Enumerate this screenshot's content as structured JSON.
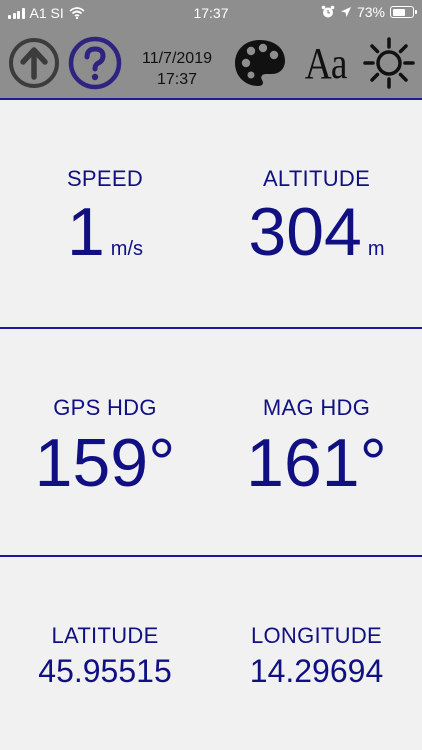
{
  "status_bar": {
    "carrier": "A1 SI",
    "time": "17:37",
    "battery": "73%",
    "battery_level": 0.73
  },
  "toolbar": {
    "date": "11/7/2019",
    "time": "17:37",
    "font_button_label": "Aa"
  },
  "panels": {
    "speed": {
      "label": "SPEED",
      "value": "1",
      "unit": "m/s"
    },
    "altitude": {
      "label": "ALTITUDE",
      "value": "304",
      "unit": "m"
    },
    "gps_heading": {
      "label": "GPS HDG",
      "value": "159°"
    },
    "mag_heading": {
      "label": "MAG HDG",
      "value": "161°"
    },
    "latitude": {
      "label": "LATITUDE",
      "value": "45.95515"
    },
    "longitude": {
      "label": "LONGITUDE",
      "value": "14.29694"
    }
  },
  "colors": {
    "accent": "#101082",
    "divider": "#1b1b9a",
    "toolbar_bg": "#8e8e8e",
    "content_bg": "#f1f1f2"
  }
}
